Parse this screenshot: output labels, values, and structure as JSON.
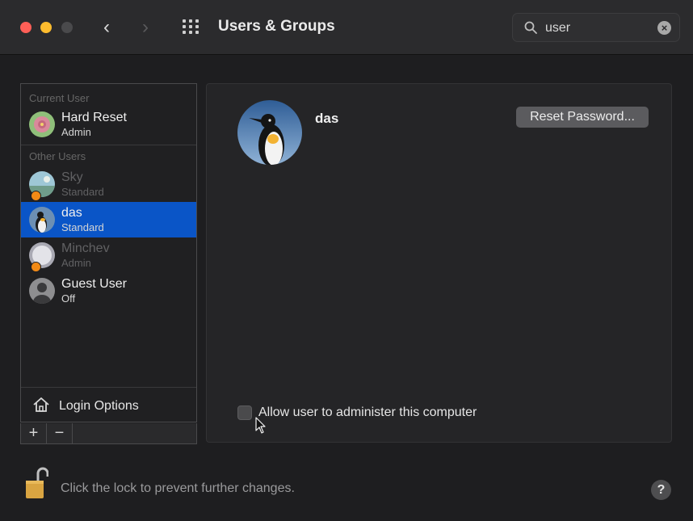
{
  "window": {
    "title": "Users & Groups",
    "back_glyph": "‹",
    "forward_glyph": "›"
  },
  "search": {
    "value": "user",
    "clear_glyph": "×"
  },
  "sidebar": {
    "current_user_label": "Current User",
    "current_user": {
      "name": "Hard Reset",
      "role": "Admin"
    },
    "other_users_label": "Other Users",
    "other_users": [
      {
        "name": "Sky",
        "role": "Standard",
        "dimmed": true,
        "selected": false
      },
      {
        "name": "das",
        "role": "Standard",
        "dimmed": false,
        "selected": true
      },
      {
        "name": "Minchev",
        "role": "Admin",
        "dimmed": true,
        "selected": false
      },
      {
        "name": "Guest User",
        "role": "Off",
        "dimmed": false,
        "selected": false
      }
    ],
    "login_options_label": "Login Options",
    "add_glyph": "+",
    "remove_glyph": "−"
  },
  "main": {
    "user_name": "das",
    "reset_password_label": "Reset Password...",
    "admin_checkbox_label": "Allow user to administer this computer",
    "admin_checked": false
  },
  "footer": {
    "lock_text": "Click the lock to prevent further changes.",
    "help_glyph": "?"
  },
  "colors": {
    "selection": "#0a55c7",
    "badge": "#f28a16",
    "lock": "#d9a441"
  }
}
